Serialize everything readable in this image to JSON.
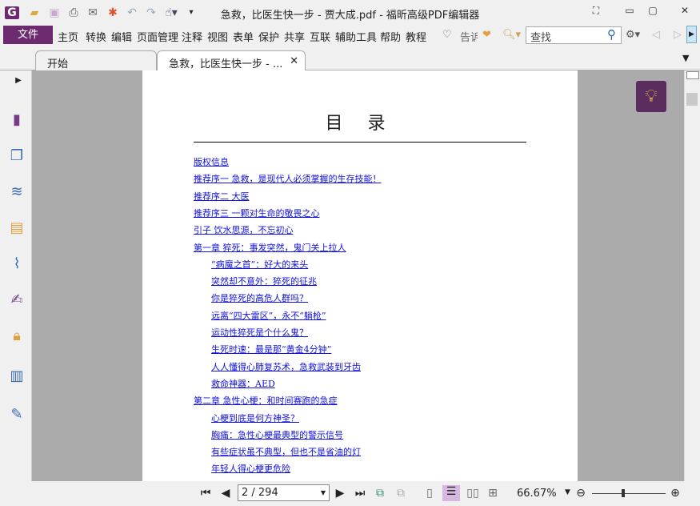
{
  "window": {
    "title": "急救，比医生快一步 - 贾大成.pdf - 福昕高级PDF编辑器"
  },
  "menu": {
    "file": "文件",
    "items": [
      "主页",
      "转换",
      "编辑",
      "页面管理",
      "注释",
      "视图",
      "表单",
      "保护",
      "共享",
      "互联",
      "辅助工具",
      "帮助",
      "教程"
    ],
    "tell": "告诉"
  },
  "search": {
    "placeholder": "查找"
  },
  "tabs": [
    {
      "label": "开始"
    },
    {
      "label": "急救，比医生快一步 - ..."
    }
  ],
  "document": {
    "toc_title": "目 录",
    "entries": [
      {
        "text": "版权信息",
        "level": 0
      },
      {
        "text": "推荐序一 急救，是现代人必须掌握的生存技能！",
        "level": 0
      },
      {
        "text": "推荐序二 大医",
        "level": 0
      },
      {
        "text": "推荐序三 一颗对生命的敬畏之心",
        "level": 0
      },
      {
        "text": "引子 饮水思源，不忘初心",
        "level": 0
      },
      {
        "text": "第一章 猝死：事发突然，鬼门关上拉人",
        "level": 0
      },
      {
        "text": "“病魔之首”：好大的来头",
        "level": 1
      },
      {
        "text": "突然却不意外：猝死的征兆",
        "level": 1
      },
      {
        "text": "你是猝死的高危人群吗？",
        "level": 1
      },
      {
        "text": "远离“四大雷区”，永不“躺枪”",
        "level": 1
      },
      {
        "text": "运动性猝死是个什么鬼？",
        "level": 1
      },
      {
        "text": "生死时速：最是那“黄金4分钟”",
        "level": 1
      },
      {
        "text": "人人懂得心肺复苏术，急救武装到牙齿",
        "level": 1
      },
      {
        "text": "救命神器：AED",
        "level": 1
      },
      {
        "text": "第二章 急性心梗：和时间赛跑的急症",
        "level": 0
      },
      {
        "text": "心梗到底是何方神圣？",
        "level": 1
      },
      {
        "text": "胸痛：急性心梗最典型的警示信号",
        "level": 1
      },
      {
        "text": "有些症状虽不典型，但也不是省油的灯",
        "level": 1
      },
      {
        "text": "年轻人得心梗更危险",
        "level": 1
      }
    ]
  },
  "status": {
    "page": "2 / 294",
    "zoom": "66.67%",
    "zoom_slider_percent": 66.67
  },
  "colors": {
    "brand": "#6c2b6f",
    "link": "#1010e0"
  }
}
